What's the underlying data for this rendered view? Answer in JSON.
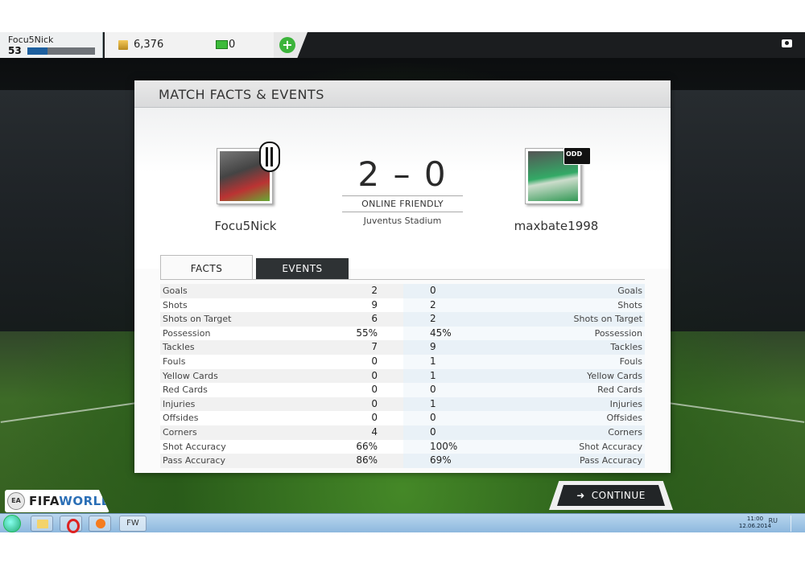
{
  "topbar": {
    "user_name": "Focu5Nick",
    "user_level": "53",
    "xp_progress": 0.3,
    "coins": "6,376",
    "points": "0"
  },
  "panel": {
    "title": "MATCH FACTS & EVENTS"
  },
  "match": {
    "home_player": "Focu5Nick",
    "away_player": "maxbate1998",
    "score": "2 – 0",
    "match_type": "ONLINE FRIENDLY",
    "stadium": "Juventus Stadium"
  },
  "tabs": {
    "facts": "FACTS",
    "events": "EVENTS"
  },
  "stats": [
    {
      "label": "Goals",
      "home": "2",
      "away": "0"
    },
    {
      "label": "Shots",
      "home": "9",
      "away": "2"
    },
    {
      "label": "Shots on Target",
      "home": "6",
      "away": "2"
    },
    {
      "label": "Possession",
      "home": "55%",
      "away": "45%"
    },
    {
      "label": "Tackles",
      "home": "7",
      "away": "9"
    },
    {
      "label": "Fouls",
      "home": "0",
      "away": "1"
    },
    {
      "label": "Yellow Cards",
      "home": "0",
      "away": "1"
    },
    {
      "label": "Red Cards",
      "home": "0",
      "away": "0"
    },
    {
      "label": "Injuries",
      "home": "0",
      "away": "1"
    },
    {
      "label": "Offsides",
      "home": "0",
      "away": "0"
    },
    {
      "label": "Corners",
      "home": "4",
      "away": "0"
    },
    {
      "label": "Shot Accuracy",
      "home": "66%",
      "away": "100%"
    },
    {
      "label": "Pass Accuracy",
      "home": "86%",
      "away": "69%"
    }
  ],
  "footer": {
    "logo_ea": "EA",
    "logo_fifa": "FIFA",
    "logo_world": "WORLD",
    "continue_label": "CONTINUE",
    "continue_icon": "arrow-right-icon"
  },
  "taskbar": {
    "app_label": "FW",
    "language": "RU",
    "time": "11:00",
    "date": "12.06.2014"
  }
}
